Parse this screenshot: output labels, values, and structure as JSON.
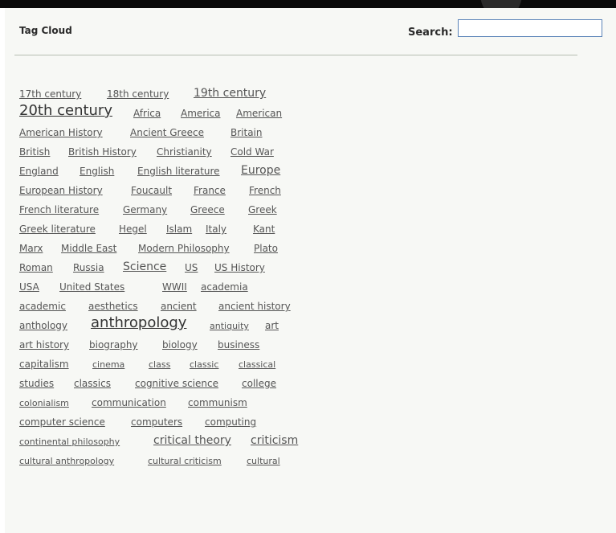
{
  "panel": {
    "title": "Tag Cloud"
  },
  "search": {
    "label": "Search:",
    "value": ""
  },
  "tags": [
    "17th century",
    "18th century",
    "19th century",
    "20th century",
    "Africa",
    "America",
    "American",
    "American History",
    "Ancient Greece",
    "Britain",
    "British",
    "British History",
    "Christianity",
    "Cold War",
    "England",
    "English",
    "English literature",
    "Europe",
    "European History",
    "Foucault",
    "France",
    "French",
    "French literature",
    "Germany",
    "Greece",
    "Greek",
    "Greek literature",
    "Hegel",
    "Islam",
    "Italy",
    "Kant",
    "Marx",
    "Middle East",
    "Modern Philosophy",
    "Plato",
    "Roman",
    "Russia",
    "Science",
    "US",
    "US History",
    "USA",
    "United States",
    "WWII",
    "academia",
    "academic",
    "aesthetics",
    "ancient",
    "ancient history",
    "anthology",
    "anthropology",
    "antiquity",
    "art",
    "art history",
    "biography",
    "biology",
    "business",
    "capitalism",
    "cinema",
    "class",
    "classic",
    "classical",
    "studies",
    "classics",
    "cognitive science",
    "college",
    "colonialism",
    "communication",
    "communism",
    "computer science",
    "computers",
    "computing",
    "continental philosophy",
    "critical theory",
    "criticism",
    "cultural anthropology",
    "cultural criticism",
    "cultural"
  ]
}
